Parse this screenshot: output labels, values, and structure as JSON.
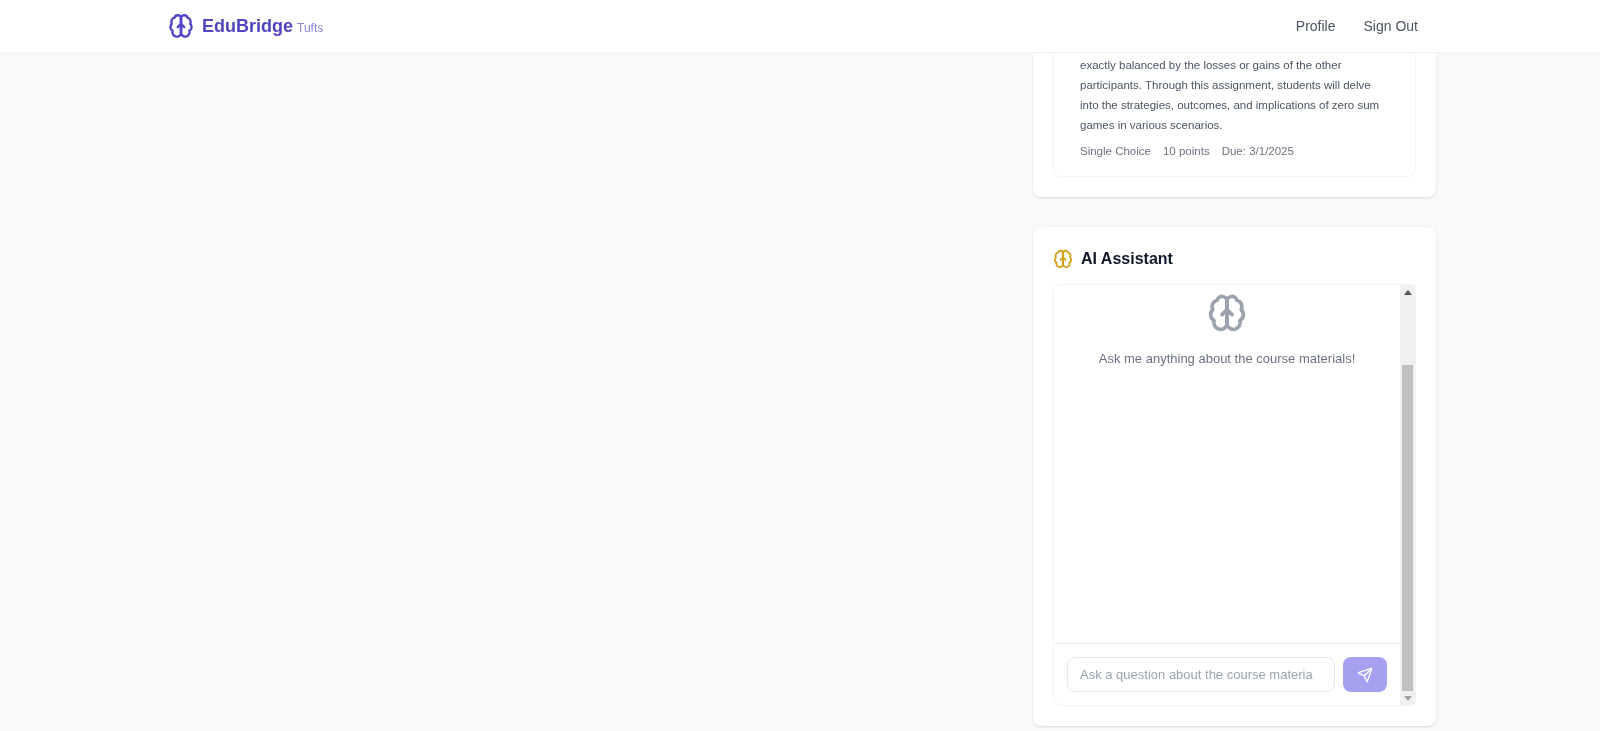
{
  "header": {
    "brand": "EduBridge",
    "school": "Tufts",
    "nav": [
      "Profile",
      "Sign Out"
    ]
  },
  "assignment": {
    "description": "exactly balanced by the losses or gains of the other participants. Through this assignment, students will delve into the strategies, outcomes, and implications of zero sum games in various scenarios.",
    "type": "Single Choice",
    "points": "10 points",
    "due": "Due: 3/1/2025"
  },
  "assistant": {
    "title": "AI Assistant",
    "empty_message": "Ask me anything about the course materials!",
    "input": {
      "placeholder": "Ask a question about the course materia"
    }
  }
}
